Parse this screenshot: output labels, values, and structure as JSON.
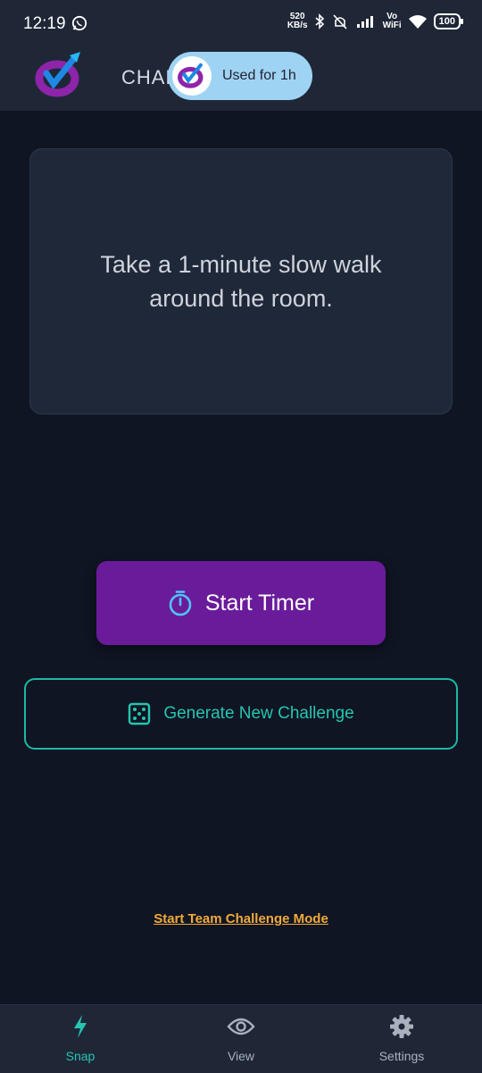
{
  "status_bar": {
    "time": "12:19",
    "net_speed_top": "520",
    "net_speed_bottom": "KB/s",
    "vo": "Vo",
    "wifi": "WiFi",
    "battery": "100"
  },
  "app_bar": {
    "title": "CHAL"
  },
  "toast": {
    "text": "Used for 1h"
  },
  "challenge": {
    "text": "Take a 1-minute slow walk around the room."
  },
  "buttons": {
    "start_timer": "Start Timer",
    "generate": "Generate New Challenge",
    "team_mode": "Start Team Challenge Mode"
  },
  "nav": {
    "items": [
      {
        "label": "Snap",
        "icon": "lightning-icon",
        "active": true
      },
      {
        "label": "View",
        "icon": "eye-icon",
        "active": false
      },
      {
        "label": "Settings",
        "icon": "gear-icon",
        "active": false
      }
    ]
  },
  "colors": {
    "background": "#0f1523",
    "surface": "#1f2737",
    "primary_purple": "#6a1b9a",
    "teal": "#27c4b0",
    "link_orange": "#f2a93b"
  }
}
